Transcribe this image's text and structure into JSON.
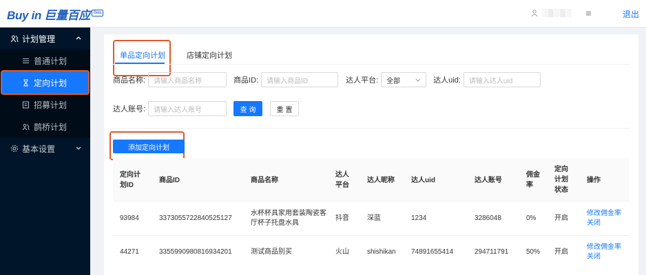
{
  "header": {
    "logo_text": "Buy in",
    "logo_brand": "巨量百应",
    "logo_badge": "Beta",
    "user_name": "░▒░▒░",
    "logout": "退出"
  },
  "sidebar": {
    "group1": "计划管理",
    "items": [
      {
        "label": "普通计划"
      },
      {
        "label": "定向计划"
      },
      {
        "label": "招募计划"
      },
      {
        "label": "鹊桥计划"
      }
    ],
    "group2": "基本设置"
  },
  "tabs": [
    {
      "label": "单品定向计划"
    },
    {
      "label": "店铺定向计划"
    }
  ],
  "form": {
    "product_name_label": "商品名称:",
    "product_name_placeholder": "请输入商品名称",
    "product_id_label": "商品ID:",
    "product_id_placeholder": "请输入商品ID",
    "platform_label": "达人平台:",
    "platform_value": "全部",
    "uid_label": "达人uid:",
    "uid_placeholder": "请输入达人uid",
    "account_label": "达人账号:",
    "account_placeholder": "请输入达人账号",
    "query_button": "查 询",
    "reset_button": "重 置"
  },
  "add_button": "添加定向计划",
  "table": {
    "headers": {
      "plan_id": [
        "定向计",
        "划ID"
      ],
      "product_id": "商品ID",
      "product_name": "商品名称",
      "platform": [
        "达人",
        "平台"
      ],
      "nickname": "达人昵称",
      "uid": "达人uid",
      "account": "达人账号",
      "commission": [
        "佣金",
        "率"
      ],
      "status": [
        "定向",
        "计划",
        "状态"
      ],
      "actions": "操作"
    },
    "rows": [
      {
        "plan_id": "93984",
        "product_id": "3373055722840525127",
        "product_name": [
          "水杯杯具家用套装陶瓷客",
          "厅杯子托盘水具"
        ],
        "platform": "抖音",
        "nickname": "深蓝",
        "uid": "1234",
        "account": "3286048",
        "commission": "0%",
        "status": "开启",
        "action1": "修改佣金率",
        "action2": "关闭"
      },
      {
        "plan_id": "44271",
        "product_id": "3355990980816934201",
        "product_name": [
          "测试商品别买",
          ""
        ],
        "platform": "火山",
        "nickname": "shishikan",
        "uid": "74891655414",
        "account": "294711791",
        "commission": "50%",
        "status": "开启",
        "action1": "修改佣金率",
        "action2": "关闭"
      }
    ]
  },
  "colors": {
    "primary": "#1677ff",
    "sidebar_bg": "#001529",
    "highlight": "#e0592a"
  }
}
